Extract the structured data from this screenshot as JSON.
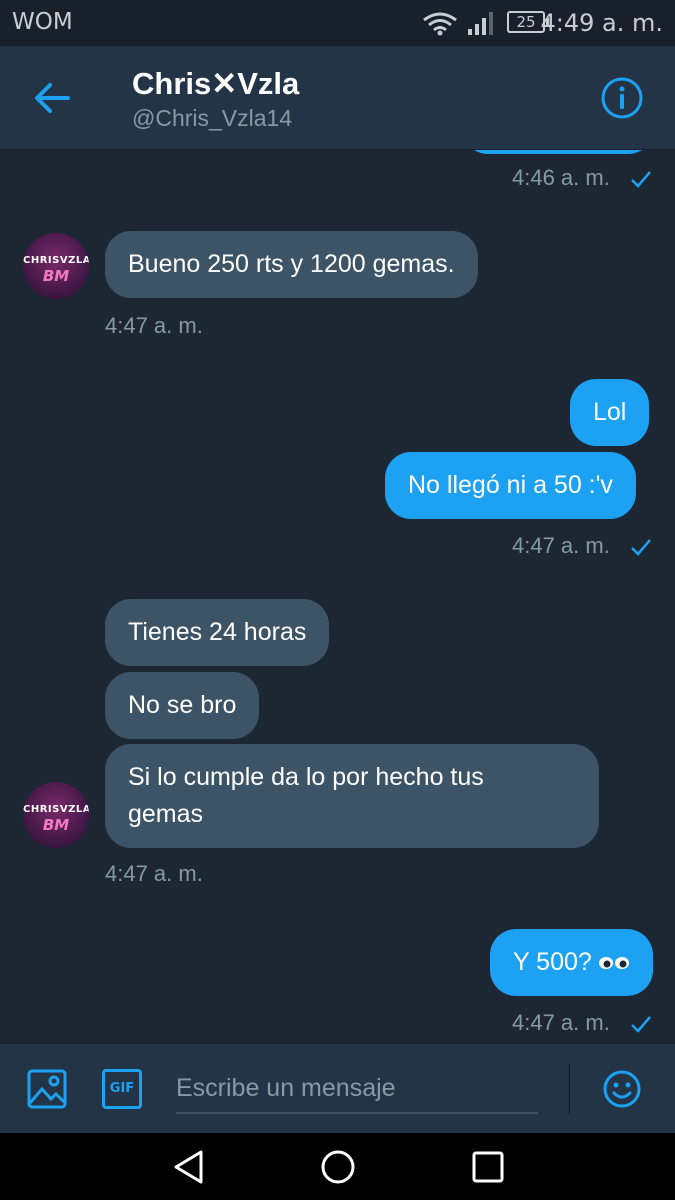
{
  "status_bar": {
    "carrier": "WOM",
    "battery": "25",
    "time": "4:49 a. m."
  },
  "header": {
    "name": "Chris✕Vzla",
    "handle": "@Chris_Vzla14"
  },
  "avatar": {
    "top_text": "CHRISVZLA",
    "bottom_text": "BM"
  },
  "messages": [
    {
      "id": "m0",
      "direction": "out",
      "timestamp": "4:46 a. m.",
      "read": true
    },
    {
      "id": "m1",
      "direction": "in",
      "text": "Bueno 250 rts y 1200 gemas.",
      "timestamp": "4:47 a. m."
    },
    {
      "id": "m2",
      "direction": "out",
      "text": "Lol"
    },
    {
      "id": "m3",
      "direction": "out",
      "text": "No llegó ni a 50 :'v",
      "timestamp": "4:47 a. m.",
      "read": true
    },
    {
      "id": "m4",
      "direction": "in",
      "text": "Tienes 24 horas"
    },
    {
      "id": "m5",
      "direction": "in",
      "text": "No se bro"
    },
    {
      "id": "m6",
      "direction": "in",
      "line1": "Si lo cumple da lo por hecho tus",
      "line2": "gemas",
      "timestamp": "4:47 a. m."
    },
    {
      "id": "m7",
      "direction": "out",
      "text": "Y 500?",
      "emoji": "eyes",
      "timestamp": "4:47 a. m.",
      "read": true
    }
  ],
  "composer": {
    "placeholder": "Escribe un mensaje",
    "gif_label": "GIF"
  },
  "colors": {
    "background": "#1c2733",
    "header": "#243447",
    "incoming_bubble": "#3d5466",
    "outgoing_bubble": "#1da1f2",
    "accent": "#1da1f2",
    "timestamp": "#8899a6"
  }
}
